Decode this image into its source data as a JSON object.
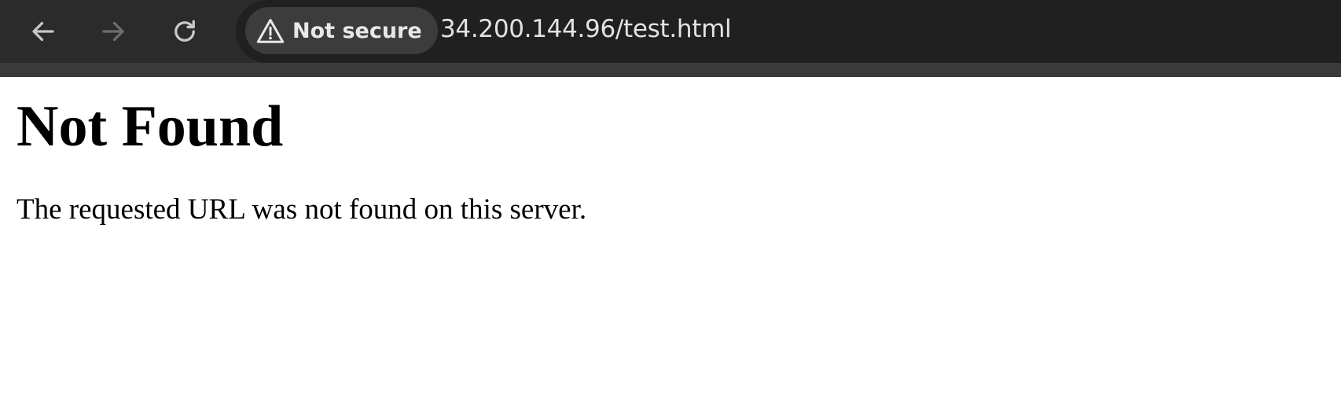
{
  "browser": {
    "security_chip": {
      "icon": "warning-triangle-icon",
      "label": "Not secure"
    },
    "address": "34.200.144.96/test.html",
    "nav": {
      "back_icon": "arrow-left-icon",
      "forward_icon": "arrow-right-icon",
      "reload_icon": "reload-icon"
    },
    "colors": {
      "toolbar": "#2b2b2b",
      "omnibox": "#202020",
      "chip": "#3c3c3c",
      "icon_active": "#c8c8c8",
      "icon_disabled": "#6e6e6e"
    }
  },
  "page": {
    "heading": "Not Found",
    "message": "The requested URL was not found on this server."
  }
}
